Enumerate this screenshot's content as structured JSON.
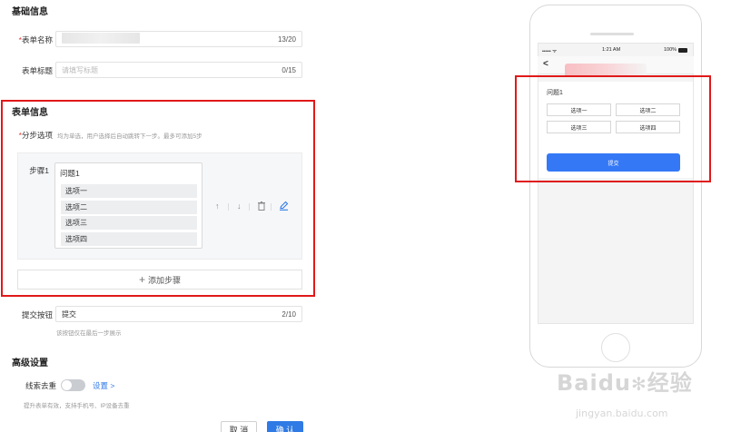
{
  "basic_section": {
    "title": "基础信息",
    "form_name": {
      "label": "表单名称",
      "required_mark": "*",
      "counter": "13/20"
    },
    "form_title": {
      "label": "表单标题",
      "placeholder": "请填写标题",
      "counter": "0/15"
    }
  },
  "form_section": {
    "title": "表单信息",
    "steps_field": {
      "required_mark": "*",
      "label": "分步选项",
      "hint": "均为单选，用户选择后自动跳转下一步。最多可添加5步"
    },
    "step": {
      "label": "步骤1",
      "question": "问题1",
      "options": [
        "选项一",
        "选项二",
        "选项三",
        "选项四"
      ],
      "controls": {
        "up": "↑",
        "down": "↓",
        "delete": "🗑",
        "edit": "✎"
      }
    },
    "add_step": {
      "icon": "+",
      "label": "添加步骤"
    },
    "submit_field": {
      "label": "提交按钮",
      "value": "提交",
      "counter": "2/10",
      "hint": "该按钮仅在最后一步展示"
    }
  },
  "advanced_section": {
    "title": "高级设置",
    "dedupe": {
      "label": "线索去重",
      "enabled": false,
      "settings_link": "设置 >",
      "hint": "提升表单有效，支持手机号、IP设备去重"
    }
  },
  "actions": {
    "cancel": "取 消",
    "confirm": "确 认"
  },
  "preview": {
    "status_time": "1:21 AM",
    "status_battery": "100%",
    "back_icon": "<",
    "question": "问题1",
    "options": [
      "选项一",
      "选项二",
      "选项三",
      "选项四"
    ],
    "submit": "提交"
  },
  "watermark": {
    "brand": "Baidu",
    "brand_cn": "经验",
    "url": "jingyan.baidu.com"
  },
  "colors": {
    "accent": "#2f7ae5",
    "highlight_frame": "#e0191a",
    "required": "#e53935"
  }
}
